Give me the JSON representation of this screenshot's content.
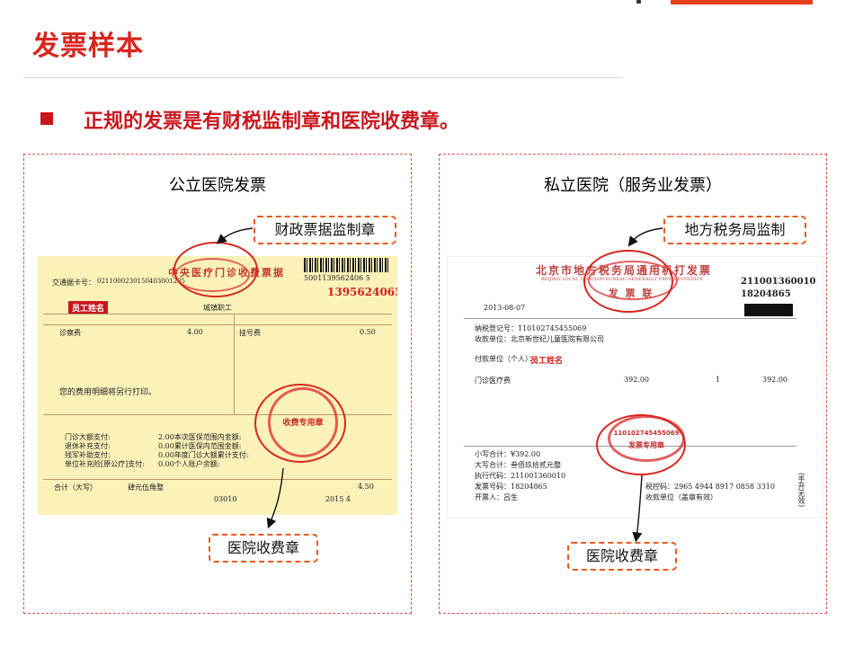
{
  "title": "发票样本",
  "lead": "正规的发票是有财税监制章和医院收费章。",
  "panels": {
    "public": {
      "heading": "公立医院发票",
      "callout_top": "财政票据监制章",
      "callout_bottom": "医院收费章",
      "invoice": {
        "header": "中央医疗门诊收费票据",
        "barcode_number": "5001139562406 5",
        "serial": "1395624065",
        "name_label": "员工姓名",
        "fields": {
          "card_label": "交通据卡号：",
          "card_value": "0211000230150403001205",
          "org": "城镇职工",
          "item_left": "诊察费",
          "item_left_value": "4.00",
          "item_right": "挂号费",
          "item_right_value": "0.50",
          "note": "您的费用明细将另行打印。",
          "pay1": "门诊大额支付:",
          "pay2": "退休补充支付:",
          "pay3": "残军补助支付:",
          "pay4": "单位补充险[原公疗]支付:",
          "amt1": "2.00本次医保范围内金额:",
          "amt2": "0.00累计医保内范围金额:",
          "amt3": "0.00年度门诊大额累计支付:",
          "amt4": "0.00个人账户余额:",
          "total_label": "合计（大写）",
          "total_words": "肆元伍角整",
          "total_value": "4.50",
          "code": "03010",
          "date": "2015 4"
        },
        "seal_text": "收费专用章"
      }
    },
    "private": {
      "heading": "私立医院（服务业发票）",
      "callout_top": "地方税务局监制",
      "callout_bottom": "医院收费章",
      "invoice": {
        "header": "北京市地方税务局通用机打发票",
        "header_en": "BEIJING LOCAL TAXATION BUREAU GENERALLY PRINTED INVOICE",
        "sub_header": "发 票 联",
        "code": "211001360010",
        "number": "18204865",
        "date": "2013-08-07",
        "name_label": "员工姓名",
        "fields": {
          "payee_no": "纳税登记号：110102745455069",
          "payee_name": "收款单位：北京新世纪儿童医院有限公司",
          "payer": "付款单位（个人）：",
          "item": "门诊医疗费",
          "amount": "392.00",
          "qty": "1",
          "total_small": "小写合计：¥392.00",
          "total_big": "大写合计：叁佰玖拾贰元整",
          "machine": "执行代码：211001360010",
          "invoice_no": "发票号码：18204865",
          "tax_no": "税控码：2965 4944 8917 0858 3310",
          "operator": "收款单位（盖章有效）",
          "clerk": "开票人：吕生"
        },
        "side_label": "(手开无效)",
        "seal_number": "110102745455069",
        "seal_text": "发票专用章"
      }
    }
  }
}
